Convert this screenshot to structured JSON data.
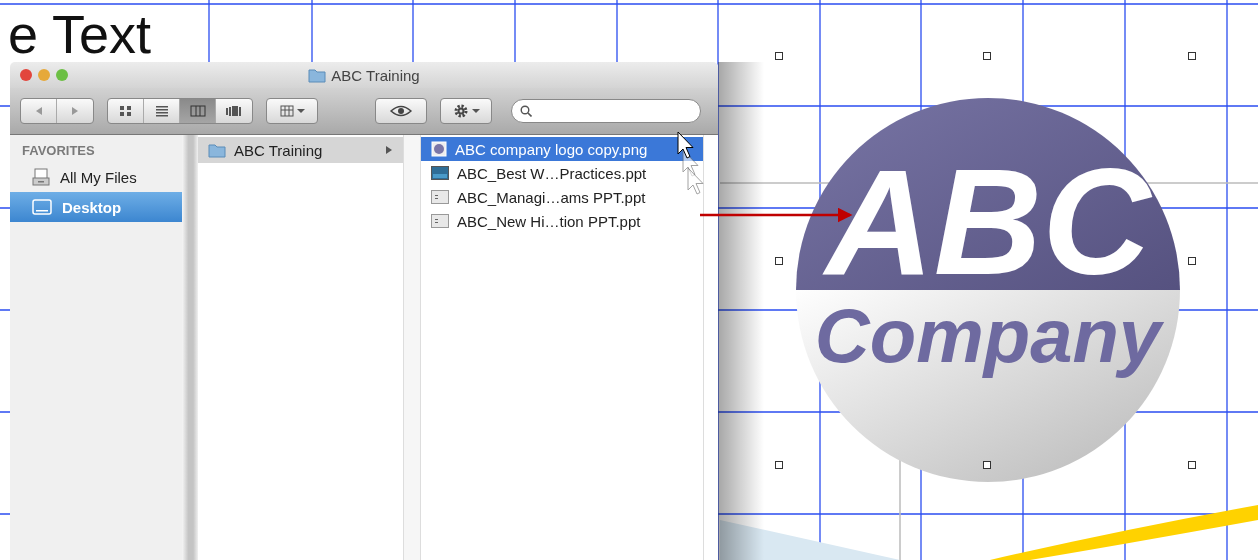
{
  "document": {
    "heading": "e Text",
    "logo": {
      "title": "ABC",
      "subtitle": "Company"
    }
  },
  "window": {
    "title": "ABC Training"
  },
  "toolbar": {
    "view_modes": [
      {
        "kind": "icons",
        "selected": false
      },
      {
        "kind": "list",
        "selected": false
      },
      {
        "kind": "columns",
        "selected": true
      },
      {
        "kind": "coverflow",
        "selected": false
      }
    ]
  },
  "sidebar": {
    "header": "FAVORITES",
    "items": [
      {
        "label": "All My Files",
        "kind": "files",
        "selected": false
      },
      {
        "label": "Desktop",
        "kind": "desktop",
        "selected": true
      }
    ]
  },
  "columns": [
    {
      "items": [
        {
          "label": "ABC Training",
          "kind": "folder",
          "selected": true
        }
      ]
    },
    {
      "items": [
        {
          "label": "ABC company logo copy.png",
          "kind": "image",
          "selected": true
        },
        {
          "label": "ABC_Best W…Practices.ppt",
          "kind": "slides",
          "selected": false
        },
        {
          "label": "ABC_Managi…ams PPT.ppt",
          "kind": "document",
          "selected": false
        },
        {
          "label": "ABC_New Hi…tion PPT.ppt",
          "kind": "document",
          "selected": false
        }
      ]
    }
  ]
}
